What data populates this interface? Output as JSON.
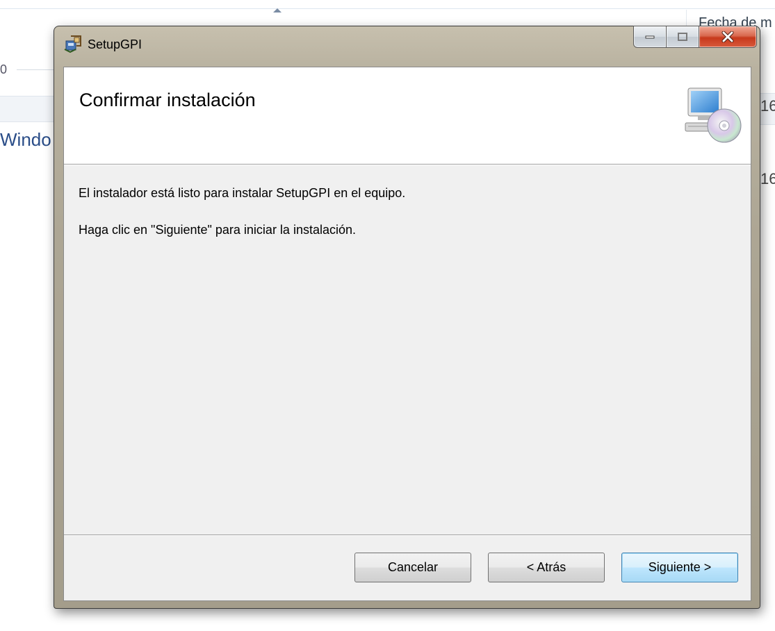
{
  "background": {
    "left_partial_number": "0",
    "left_partial_text": "Windo",
    "right_top_partial": "Fecha de m",
    "right_partial_number_1": "16",
    "right_partial_number_2": "16"
  },
  "window": {
    "title": "SetupGPI",
    "icon": "installer-icon",
    "caption_buttons": [
      "minimize",
      "maximize",
      "close"
    ]
  },
  "header": {
    "title": "Confirmar instalación",
    "icon": "computer-cd-icon"
  },
  "body": {
    "line1": "El instalador está listo para instalar SetupGPI en el equipo.",
    "line2": "Haga clic en \"Siguiente\" para iniciar la instalación."
  },
  "buttons": {
    "cancel": "Cancelar",
    "back": "< Atrás",
    "next": "Siguiente >"
  },
  "colors": {
    "frame": "#b9b2a0",
    "client_bg": "#f0f0f0",
    "header_bg": "#ffffff",
    "close_button": "#c7391c",
    "default_button_border": "#3c7fb1"
  }
}
